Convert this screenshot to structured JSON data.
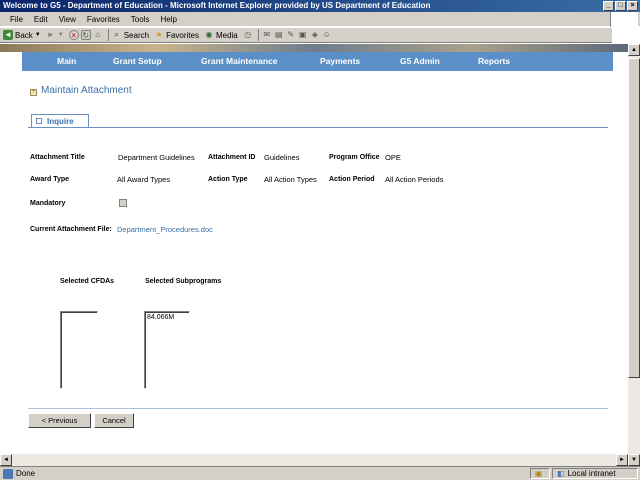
{
  "window": {
    "title": "Welcome to G5 - Department of Education - Microsoft Internet Explorer provided by US Department of Education",
    "controls": [
      "_",
      "□",
      "×"
    ]
  },
  "menu": [
    "File",
    "Edit",
    "View",
    "Favorites",
    "Tools",
    "Help"
  ],
  "toolbar": {
    "back": "Back",
    "search": "Search",
    "favorites": "Favorites",
    "media": "Media"
  },
  "nav": [
    "Main",
    "Grant Setup",
    "Grant Maintenance",
    "Payments",
    "G5 Admin",
    "Reports"
  ],
  "page": {
    "section_title": "Maintain Attachment",
    "tab": "Inquire"
  },
  "fields": {
    "attachment_title_label": "Attachment Title",
    "attachment_title_value": "Department Guidelines",
    "attachment_id_label": "Attachment ID",
    "attachment_id_value": "Guidelines",
    "program_office_label": "Program Office",
    "program_office_value": "OPE",
    "award_type_label": "Award Type",
    "award_type_value": "All Award Types",
    "action_type_label": "Action Type",
    "action_type_value": "All Action Types",
    "action_period_label": "Action Period",
    "action_period_value": "All Action Periods",
    "mandatory_label": "Mandatory",
    "current_file_label": "Current Attachment File:",
    "current_file_value": "Department_Procedures.doc"
  },
  "lists": {
    "cfdas_label": "Selected CFDAs",
    "cfdas_items": [],
    "subprograms_label": "Selected Subprograms",
    "subprograms_items": [
      "84.066M"
    ]
  },
  "buttons": {
    "previous": "< Previous",
    "cancel": "Cancel"
  },
  "status": {
    "left": "Done",
    "zone": "Local intranet"
  }
}
